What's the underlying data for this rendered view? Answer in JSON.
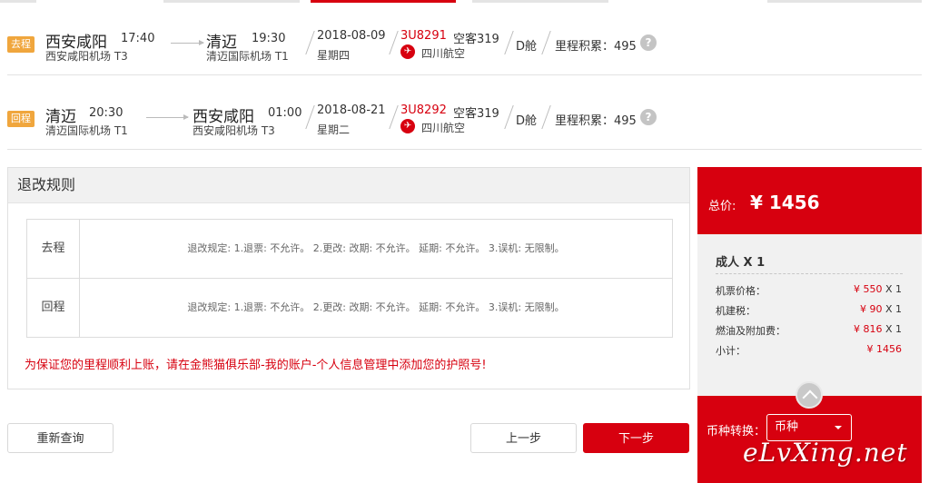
{
  "flights": [
    {
      "tag": "去程",
      "dep_city": "西安咸阳",
      "dep_time": "17:40",
      "dep_airport": "西安咸阳机场 T3",
      "arr_city": "清迈",
      "arr_time": "19:30",
      "arr_airport": "清迈国际机场 T1",
      "date": "2018-08-09",
      "weekday": "星期四",
      "flight_no": "3U8291",
      "plane": "空客319",
      "airline": "四川航空",
      "cabin": "D舱",
      "miles": "里程积累：495"
    },
    {
      "tag": "回程",
      "dep_city": "清迈",
      "dep_time": "20:30",
      "dep_airport": "清迈国际机场 T1",
      "arr_city": "西安咸阳",
      "arr_time": "01:00",
      "arr_airport": "西安咸阳机场 T3",
      "date": "2018-08-21",
      "weekday": "星期二",
      "flight_no": "3U8292",
      "plane": "空客319",
      "airline": "四川航空",
      "cabin": "D舱",
      "miles": "里程积累：495"
    }
  ],
  "rules": {
    "title": "退改规则",
    "rows": [
      {
        "label": "去程",
        "text": "退改规定: 1.退票: 不允许。 2.更改: 改期: 不允许。 延期: 不允许。 3.误机: 无限制。"
      },
      {
        "label": "回程",
        "text": "退改规定: 1.退票: 不允许。 2.更改: 改期: 不允许。 延期: 不允许。 3.误机: 无限制。"
      }
    ],
    "notice": "为保证您的里程顺利上账，请在金熊猫俱乐部-我的账户-个人信息管理中添加您的护照号!"
  },
  "buttons": {
    "requery": "重新查询",
    "prev": "上一步",
    "next": "下一步"
  },
  "price": {
    "total_label": "总价:",
    "total_amount": "¥ 1456",
    "adult": "成人 X 1",
    "items": [
      {
        "label": "机票价格：",
        "value": "¥ 550",
        "mul": "X 1"
      },
      {
        "label": "机建税：",
        "value": "¥ 90",
        "mul": "X 1"
      },
      {
        "label": "燃油及附加费：",
        "value": "¥ 816",
        "mul": "X 1"
      },
      {
        "label": "小计：",
        "value": "¥ 1456",
        "mul": ""
      }
    ]
  },
  "currency": {
    "label": "币种转换：",
    "selected": "币种"
  },
  "watermark": "eLvXing.net",
  "colors": {
    "brand_red": "#d7000f",
    "tag_orange": "#f0a63d"
  }
}
